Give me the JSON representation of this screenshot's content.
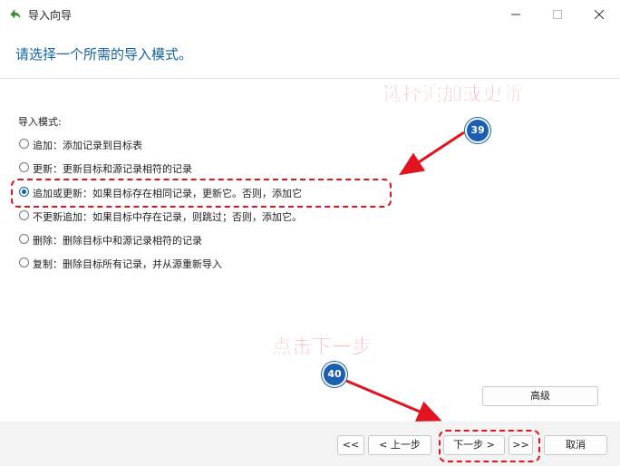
{
  "window": {
    "title": "导入向导"
  },
  "heading": "请选择一个所需的导入模式。",
  "mode_label": "导入模式:",
  "options": [
    {
      "label": "追加：添加记录到目标表",
      "selected": false
    },
    {
      "label": "更新：更新目标和源记录相符的记录",
      "selected": false
    },
    {
      "label": "追加或更新：如果目标存在相同记录，更新它。否则，添加它",
      "selected": true
    },
    {
      "label": "不更新追加：如果目标中存在记录，则跳过；否则，添加它。",
      "selected": false
    },
    {
      "label": "删除：删除目标中和源记录相符的记录",
      "selected": false
    },
    {
      "label": "复制：删除目标所有记录，并从源重新导入",
      "selected": false
    }
  ],
  "annotations": {
    "choose_text": "选择追加或更新",
    "choose_step": "39",
    "next_text": "点击下一步",
    "next_step": "40",
    "color": "#ff1a1a"
  },
  "buttons": {
    "advanced": "高级",
    "first": "<<",
    "prev": "< 上一步",
    "next": "下一步 >",
    "last": ">>",
    "cancel": "取消"
  },
  "colors": {
    "accent": "#1464a5",
    "badge": "#1b5fb3"
  }
}
